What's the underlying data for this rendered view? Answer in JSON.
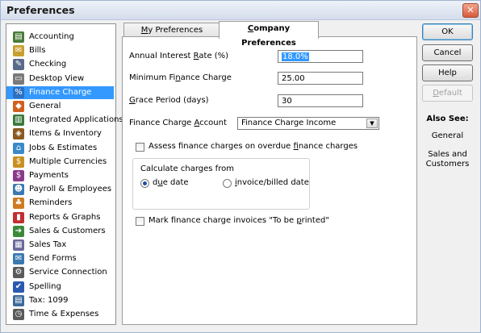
{
  "window": {
    "title": "Preferences",
    "close_glyph": "✕"
  },
  "sidebar": {
    "items": [
      {
        "label": "Accounting",
        "icon": "accounting-icon",
        "glyph": "▤",
        "color": "#4a7b3a"
      },
      {
        "label": "Bills",
        "icon": "bills-icon",
        "glyph": "✉",
        "color": "#c8a030"
      },
      {
        "label": "Checking",
        "icon": "checking-icon",
        "glyph": "✎",
        "color": "#5a6a8a"
      },
      {
        "label": "Desktop View",
        "icon": "desktop-view-icon",
        "glyph": "▭",
        "color": "#7a7a7a"
      },
      {
        "label": "Finance Charge",
        "icon": "finance-charge-icon",
        "glyph": "%",
        "color": "#2f6fbf"
      },
      {
        "label": "General",
        "icon": "general-icon",
        "glyph": "◆",
        "color": "#d06020"
      },
      {
        "label": "Integrated Applications",
        "icon": "integrated-applications-icon",
        "glyph": "▥",
        "color": "#3a7a3a"
      },
      {
        "label": "Items & Inventory",
        "icon": "items-inventory-icon",
        "glyph": "◈",
        "color": "#8a5a20"
      },
      {
        "label": "Jobs & Estimates",
        "icon": "jobs-estimates-icon",
        "glyph": "⌂",
        "color": "#3a8ac8"
      },
      {
        "label": "Multiple Currencies",
        "icon": "multiple-currencies-icon",
        "glyph": "$",
        "color": "#c89020"
      },
      {
        "label": "Payments",
        "icon": "payments-icon",
        "glyph": "$",
        "color": "#8a3a8a"
      },
      {
        "label": "Payroll & Employees",
        "icon": "payroll-employees-icon",
        "glyph": "☻",
        "color": "#3a7ab0"
      },
      {
        "label": "Reminders",
        "icon": "reminders-icon",
        "glyph": "♣",
        "color": "#d07a20"
      },
      {
        "label": "Reports & Graphs",
        "icon": "reports-graphs-icon",
        "glyph": "▮",
        "color": "#c03030"
      },
      {
        "label": "Sales & Customers",
        "icon": "sales-customers-icon",
        "glyph": "➔",
        "color": "#3a8a3a"
      },
      {
        "label": "Sales Tax",
        "icon": "sales-tax-icon",
        "glyph": "▦",
        "color": "#6a6a9a"
      },
      {
        "label": "Send Forms",
        "icon": "send-forms-icon",
        "glyph": "✉",
        "color": "#3a7ab0"
      },
      {
        "label": "Service Connection",
        "icon": "service-connection-icon",
        "glyph": "⚙",
        "color": "#5a5a5a"
      },
      {
        "label": "Spelling",
        "icon": "spelling-icon",
        "glyph": "✔",
        "color": "#2a5ab0"
      },
      {
        "label": "Tax: 1099",
        "icon": "tax-1099-icon",
        "glyph": "▤",
        "color": "#3a6a9a"
      },
      {
        "label": "Time & Expenses",
        "icon": "time-expenses-icon",
        "glyph": "◷",
        "color": "#5a5a5a"
      }
    ],
    "selected_index": 4
  },
  "tabs": [
    {
      "label": "My Preferences",
      "underline": "M",
      "rest": "y Preferences",
      "active": false
    },
    {
      "label": "Company Preferences",
      "underline": "C",
      "rest": "ompany Preferences",
      "active": true
    }
  ],
  "form": {
    "annual_rate_label_pre": "Annual Interest ",
    "annual_rate_label_ul": "R",
    "annual_rate_label_post": "ate (%)",
    "annual_rate_value": "18.0%",
    "min_charge_label_pre": "Minimum Fi",
    "min_charge_label_ul": "n",
    "min_charge_label_post": "ance Charge",
    "min_charge_value": "25.00",
    "grace_label_ul": "G",
    "grace_label_post": "race Period (days)",
    "grace_value": "30",
    "account_label_pre": "Finance Charge ",
    "account_label_ul": "A",
    "account_label_post": "ccount",
    "account_value": "Finance Charge Income",
    "assess_pre": "Assess finance charges on overdue ",
    "assess_ul": "f",
    "assess_post": "inance charges",
    "assess_checked": false,
    "calc_label": "Calculate charges from",
    "radio_due_pre": "d",
    "radio_due_ul": "u",
    "radio_due_post": "e date",
    "radio_due_selected": true,
    "radio_invoice_ul": "i",
    "radio_invoice_post": "nvoice/billed date",
    "radio_invoice_selected": false,
    "mark_pre": "Mark finance charge invoices \"To be ",
    "mark_ul": "p",
    "mark_post": "rinted\"",
    "mark_checked": false
  },
  "buttons": {
    "ok": "OK",
    "cancel": "Cancel",
    "help": "Help",
    "default_ul": "D",
    "default_rest": "efault"
  },
  "also_see": {
    "title": "Also See:",
    "links": [
      "General",
      "Sales and Customers"
    ]
  }
}
